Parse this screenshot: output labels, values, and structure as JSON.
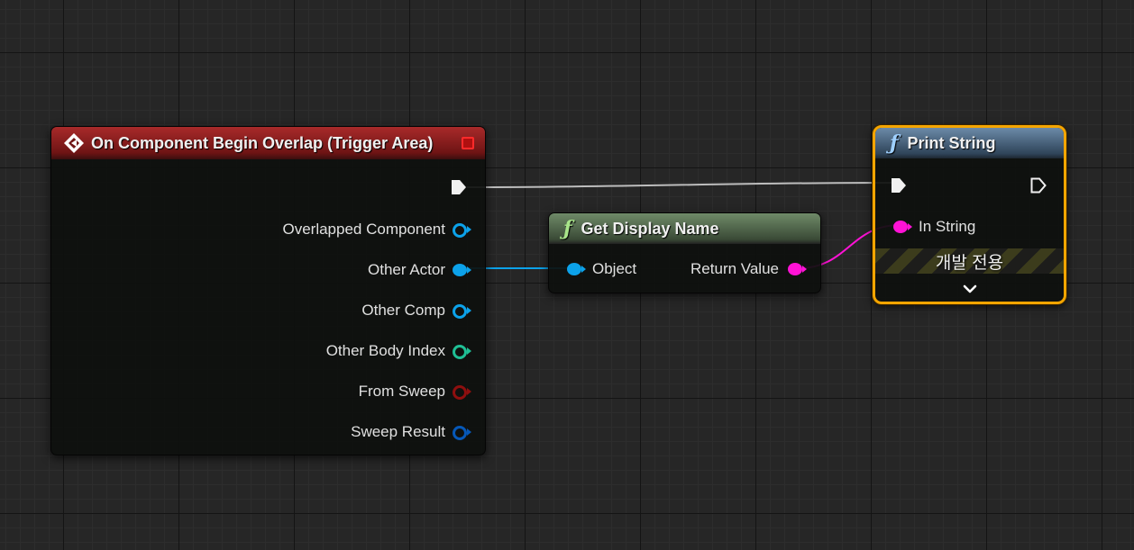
{
  "colors": {
    "exec": "#f0f0f0",
    "object": "#0ca2ea",
    "integer": "#1fbf95",
    "boolean": "#8f0f0f",
    "struct": "#0658b8",
    "string": "#ff12d6",
    "event": "#a82a2a",
    "selection": "#f4a500"
  },
  "nodes": {
    "event": {
      "title": "On Component Begin Overlap (Trigger Area)",
      "icon": "event-diamond-icon",
      "pins": [
        "Overlapped Component",
        "Other Actor",
        "Other Comp",
        "Other Body Index",
        "From Sweep",
        "Sweep Result"
      ]
    },
    "get_display_name": {
      "title": "Get Display Name",
      "icon": "function-icon",
      "input": "Object",
      "output": "Return Value"
    },
    "print_string": {
      "title": "Print String",
      "icon": "function-icon",
      "input": "In String",
      "banner": "개발 전용",
      "expand_icon": "chevron-down-icon"
    }
  }
}
